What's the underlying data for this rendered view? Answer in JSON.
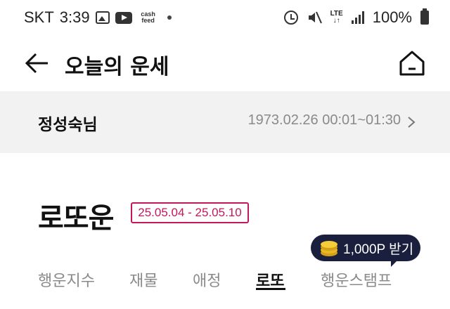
{
  "status_bar": {
    "carrier": "SKT",
    "time": "3:39",
    "cashfeed_line1": "cash",
    "cashfeed_line2": "feed",
    "lte_top": "LTE",
    "lte_bottom": "↓↑",
    "battery": "100%",
    "icons": [
      "gallery-icon",
      "youtube-icon",
      "cashfeed-icon",
      "notification-dot-icon",
      "alarm-icon",
      "mute-icon",
      "lte-icon",
      "signal-icon",
      "battery-icon"
    ]
  },
  "header": {
    "title": "오늘의 운세",
    "back_icon": "arrow-left-icon",
    "home_icon": "home-icon"
  },
  "profile": {
    "name": "정성숙님",
    "birth": "1973.02.26 00:01~01:30",
    "chevron_icon": "chevron-right-icon"
  },
  "section": {
    "title": "로또운",
    "date_range": "25.05.04 - 25.05.10",
    "accent_color": "#c2185b"
  },
  "tooltip": {
    "label": "1,000P 받기",
    "icon": "coin-stack-icon",
    "background": "#1a1f3d"
  },
  "tabs": [
    {
      "label": "행운지수",
      "active": false
    },
    {
      "label": "재물",
      "active": false
    },
    {
      "label": "애정",
      "active": false
    },
    {
      "label": "로또",
      "active": true
    },
    {
      "label": "행운스탬프",
      "active": false
    }
  ]
}
